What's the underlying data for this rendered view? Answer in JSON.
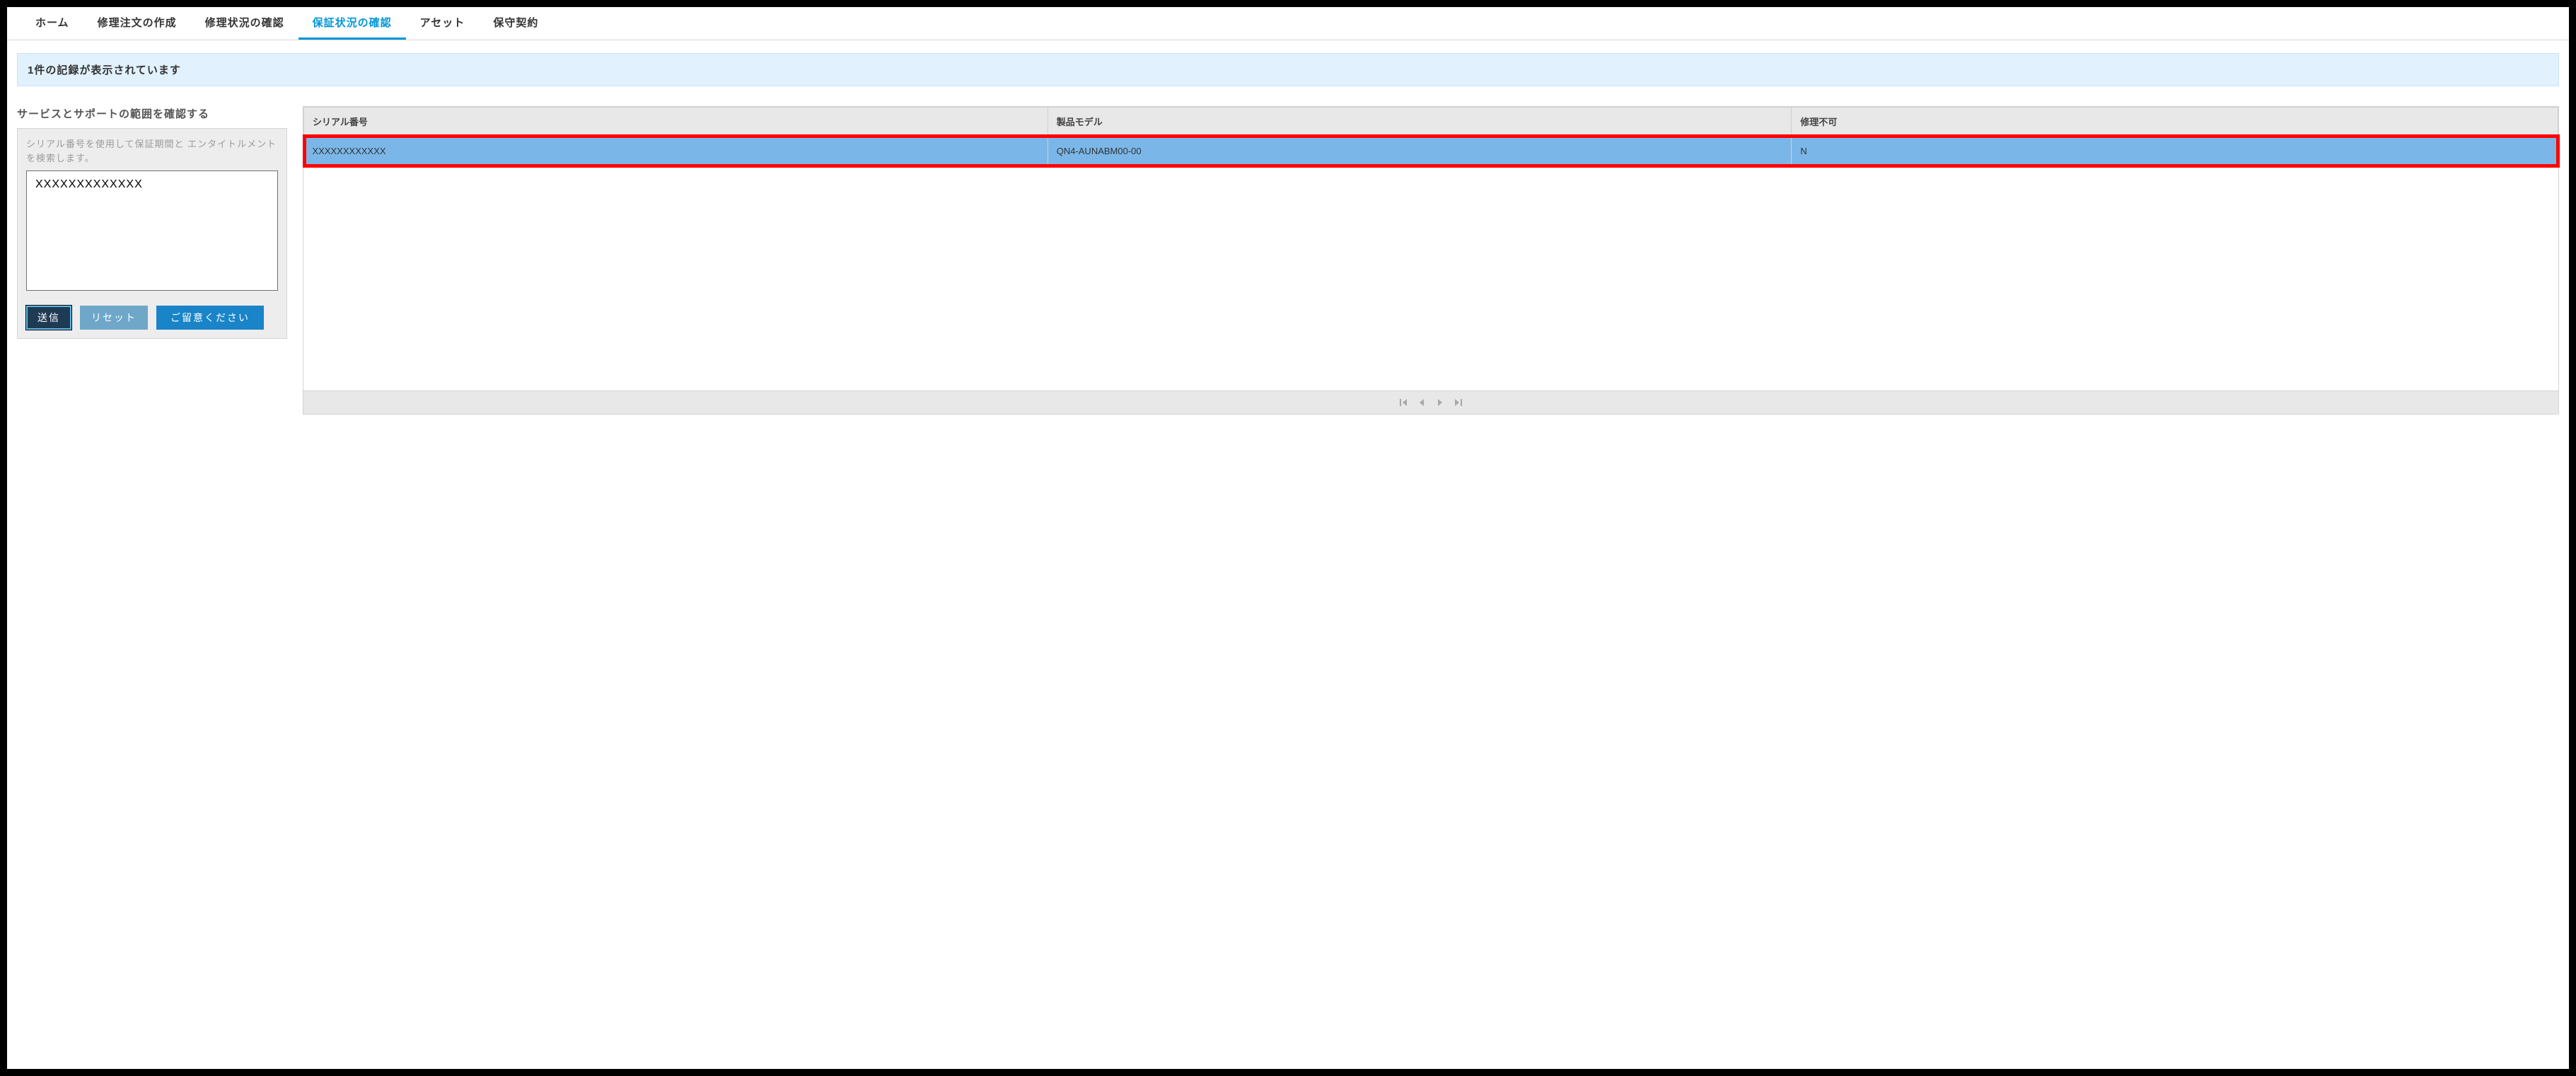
{
  "nav": {
    "items": [
      {
        "label": "ホーム",
        "id": "home",
        "active": false
      },
      {
        "label": "修理注文の作成",
        "id": "create-repair-order",
        "active": false
      },
      {
        "label": "修理状況の確認",
        "id": "repair-status",
        "active": false
      },
      {
        "label": "保証状況の確認",
        "id": "warranty-status",
        "active": true
      },
      {
        "label": "アセット",
        "id": "assets",
        "active": false
      },
      {
        "label": "保守契約",
        "id": "maintenance-contract",
        "active": false
      }
    ]
  },
  "banner": {
    "text": "1件の記録が表示されています"
  },
  "left": {
    "heading": "サービスとサポートの範囲を確認する",
    "description": "シリアル番号を使用して保証期間と エンタイトルメントを検索します。",
    "textarea_value": "XXXXXXXXXXXXX",
    "buttons": {
      "submit": "送信",
      "reset": "リセット",
      "note": "ご留意ください"
    }
  },
  "grid": {
    "columns": {
      "serial": "シリアル番号",
      "model": "製品モデル",
      "repair_impossible": "修理不可"
    },
    "rows": [
      {
        "serial": "XXXXXXXXXXXX",
        "model": "QN4-AUNABM00-00",
        "repair_impossible": "N"
      }
    ]
  }
}
